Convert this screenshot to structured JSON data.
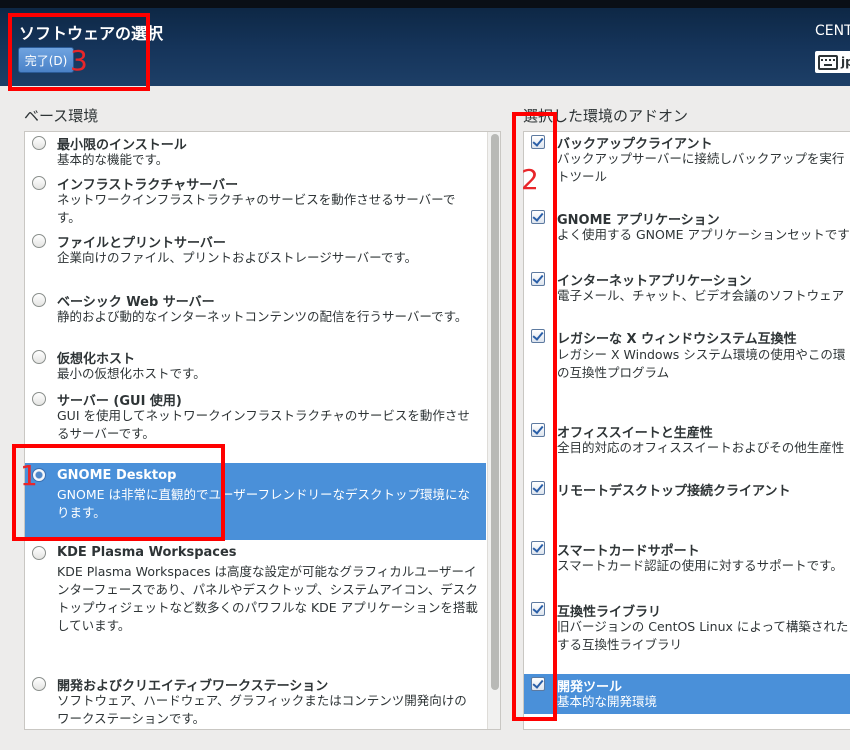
{
  "header": {
    "title": "ソフトウェアの選択",
    "done_label": "完了(D)",
    "product": "CENT",
    "keyboard_layout": "jp"
  },
  "base_env": {
    "heading": "ベース環境",
    "items": [
      {
        "title": "最小限のインストール",
        "desc": "基本的な機能です。",
        "selected": false
      },
      {
        "title": "インフラストラクチャサーバー",
        "desc": "ネットワークインフラストラクチャのサービスを動作させるサーバーです。",
        "selected": false
      },
      {
        "title": "ファイルとプリントサーバー",
        "desc": "企業向けのファイル、プリントおよびストレージサーバーです。",
        "selected": false
      },
      {
        "title": "ベーシック Web サーバー",
        "desc": "静的および動的なインターネットコンテンツの配信を行うサーバーです。",
        "selected": false
      },
      {
        "title": "仮想化ホスト",
        "desc": "最小の仮想化ホストです。",
        "selected": false
      },
      {
        "title": "サーバー (GUI 使用)",
        "desc": "GUI を使用してネットワークインフラストラクチャのサービスを動作させるサーバーです。",
        "selected": false
      },
      {
        "title": "GNOME Desktop",
        "desc": "GNOME は非常に直観的でユーザーフレンドリーなデスクトップ環境になります。",
        "selected": true
      },
      {
        "title": "KDE Plasma Workspaces",
        "desc": "KDE Plasma Workspaces は高度な設定が可能なグラフィカルユーザーインターフェースであり、パネルやデスクトップ、システムアイコン、デスクトップウィジェットなど数多くのパワフルな KDE アプリケーションを搭載しています。",
        "selected": false
      },
      {
        "title": "開発およびクリエイティブワークステーション",
        "desc": "ソフトウェア、ハードウェア、グラフィックまたはコンテンツ開発向けのワークステーションです。",
        "selected": false
      }
    ]
  },
  "addons": {
    "heading": "選択した環境のアドオン",
    "items": [
      {
        "title": "バックアップクライアント",
        "desc": "バックアップサーバーに接続しバックアップを実行\nトツール",
        "checked": true,
        "highlighted": false
      },
      {
        "title": "GNOME アプリケーション",
        "desc": "よく使用する GNOME アプリケーションセットです",
        "checked": true,
        "highlighted": false
      },
      {
        "title": "インターネットアプリケーション",
        "desc": "電子メール、チャット、ビデオ会議のソフトウェア",
        "checked": true,
        "highlighted": false
      },
      {
        "title": "レガシーな X ウィンドウシステム互換性",
        "desc": "レガシー X Windows システム環境の使用やこの環\nの互換性プログラム",
        "checked": true,
        "highlighted": false
      },
      {
        "title": "オフィススイートと生産性",
        "desc": "全目的対応のオフィススイートおよびその他生産性",
        "checked": true,
        "highlighted": false
      },
      {
        "title": "リモートデスクトップ接続クライアント",
        "desc": "",
        "checked": true,
        "highlighted": false
      },
      {
        "title": "スマートカードサポート",
        "desc": "スマートカード認証の使用に対するサポートです。",
        "checked": true,
        "highlighted": false
      },
      {
        "title": "互換性ライブラリ",
        "desc": "旧バージョンの CentOS Linux によって構築された\nする互換性ライブラリ",
        "checked": true,
        "highlighted": false
      },
      {
        "title": "開発ツール",
        "desc": "基本的な開発環境",
        "checked": true,
        "highlighted": true
      }
    ]
  },
  "annotations": {
    "label_1": "1",
    "label_2": "2",
    "label_3": "3",
    "color": "#ff0000"
  },
  "colors": {
    "selection": "#4a90d9",
    "header": "#16365a",
    "button": "#4a82c8"
  }
}
